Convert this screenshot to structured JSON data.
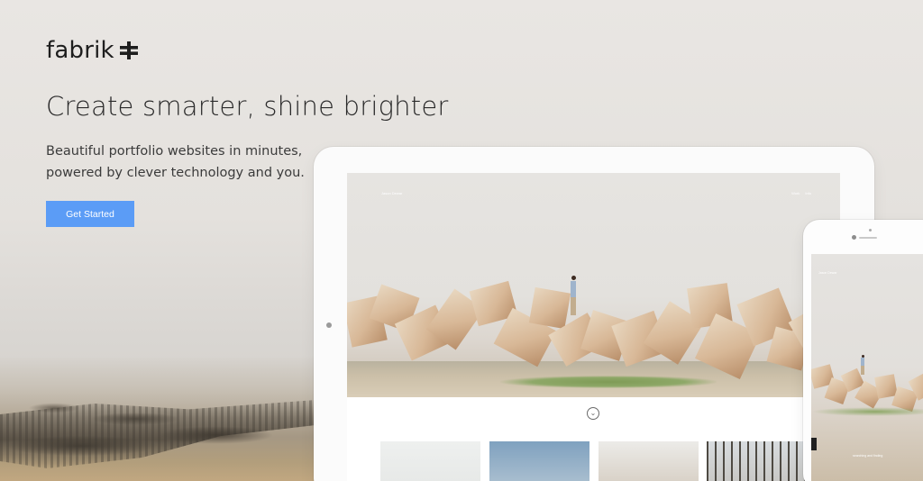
{
  "brand": {
    "name": "fabrik",
    "icon": "cross-plus-icon"
  },
  "hero": {
    "headline": "Create smarter, shine brighter",
    "subtitle_line1": "Beautiful portfolio websites in minutes,",
    "subtitle_line2": "powered by clever technology and you.",
    "cta_label": "Get Started"
  },
  "mock_site": {
    "title": "Jason Dewar",
    "menu": [
      "Work",
      "Info"
    ],
    "scroll_icon": "chevron-down-icon",
    "phone_caption": "searching and finding"
  },
  "colors": {
    "cta": "#5b9cf6",
    "background": "#e7e4e0"
  }
}
